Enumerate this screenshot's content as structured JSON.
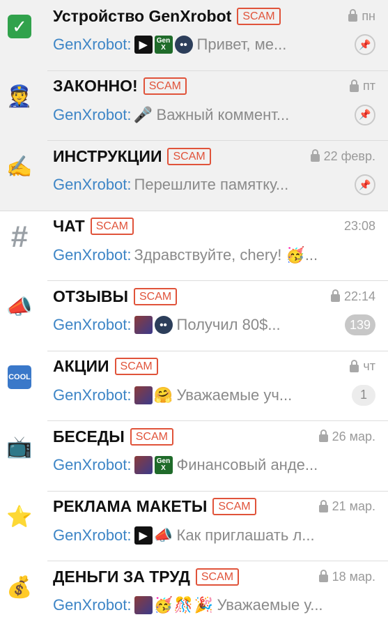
{
  "sender": "GenXrobot:",
  "scam_label": "SCAM",
  "chats": [
    {
      "title": "Устройство GenXrobot",
      "time": "пн",
      "locked": true,
      "pinned": true,
      "avatar": "✅",
      "thumbs": [
        "play",
        "gen",
        "robot"
      ],
      "preview": "Привет, ме...",
      "indicator": "pin-icon"
    },
    {
      "title": "ЗАКОННО!",
      "time": "пт",
      "locked": true,
      "pinned": true,
      "avatar": "👮",
      "thumbs": [
        "emoji:🎤"
      ],
      "preview": "Важный коммент...",
      "indicator": "pin-icon"
    },
    {
      "title": "ИНСТРУКЦИИ",
      "time": "22 февр.",
      "locked": true,
      "pinned": true,
      "avatar": "✍",
      "thumbs": [],
      "preview": "Перешлите памятку...",
      "indicator": "pin-icon"
    },
    {
      "title": "ЧАТ",
      "time": "23:08",
      "locked": false,
      "pinned": false,
      "avatar": "#",
      "thumbs": [],
      "preview": "Здравствуйте, chery! 🥳...",
      "indicator": null
    },
    {
      "title": "ОТЗЫВЫ",
      "time": "22:14",
      "locked": true,
      "pinned": false,
      "avatar": "📣",
      "thumbs": [
        "img",
        "robot"
      ],
      "preview": "Получил 80$...",
      "indicator": "badge",
      "badge": "139"
    },
    {
      "title": "АКЦИИ",
      "time": "чт",
      "locked": true,
      "pinned": false,
      "avatar": "COOL",
      "thumbs": [
        "img",
        "emoji:🤗"
      ],
      "preview": "Уважаемые уч...",
      "indicator": "badge-light",
      "badge": "1"
    },
    {
      "title": "БЕСЕДЫ",
      "time": "26 мар.",
      "locked": true,
      "pinned": false,
      "avatar": "📺",
      "thumbs": [
        "img",
        "gen"
      ],
      "preview": "Финансовый анде...",
      "indicator": null
    },
    {
      "title": "РЕКЛАМА МАКЕТЫ",
      "time": "21 мар.",
      "locked": true,
      "pinned": false,
      "avatar": "⭐",
      "thumbs": [
        "play",
        "emoji:📣"
      ],
      "preview": "Как приглашать л...",
      "indicator": null
    },
    {
      "title": "ДЕНЬГИ ЗА ТРУД",
      "time": "18 мар.",
      "locked": true,
      "pinned": false,
      "avatar": "💰",
      "thumbs": [
        "img",
        "emoji:🥳",
        "emoji:🎊",
        "emoji:🎉"
      ],
      "preview": "Уважаемые у...",
      "indicator": null
    }
  ]
}
